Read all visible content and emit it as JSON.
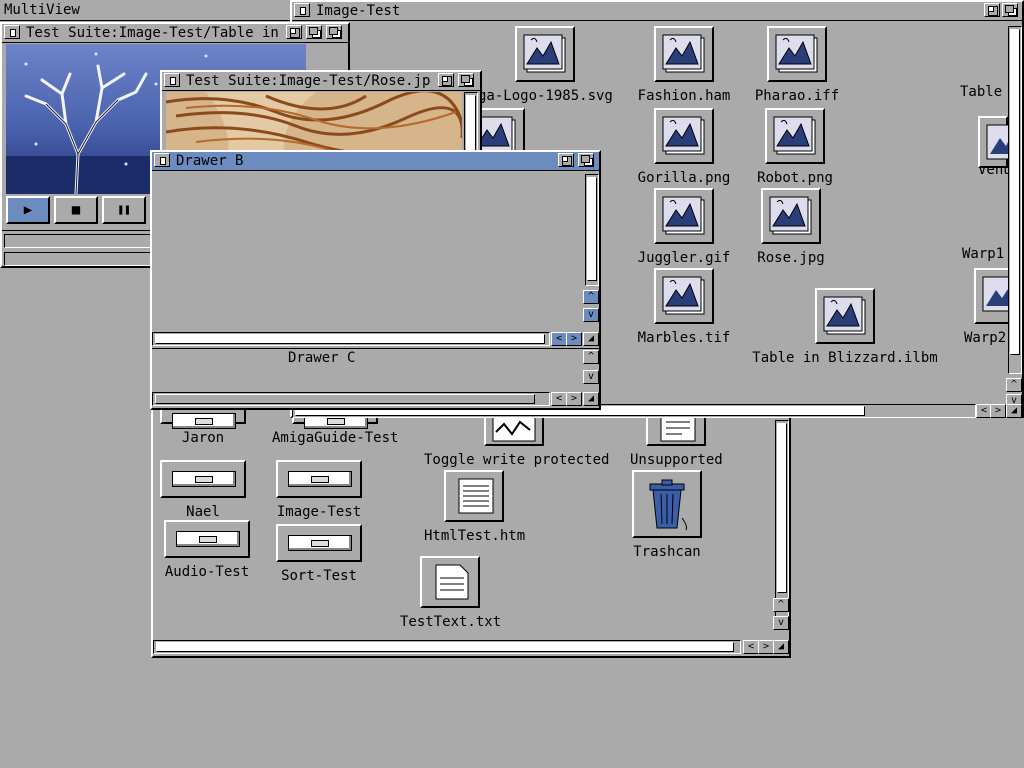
{
  "screen": {
    "title": "MultiView"
  },
  "windows": {
    "image_test": {
      "title": "Image-Test"
    },
    "table": {
      "title": "Test Suite:Image-Test/Table in"
    },
    "rose": {
      "title": "Test Suite:Image-Test/Rose.jp"
    },
    "drawer_b": {
      "title": "Drawer B"
    },
    "drawer_c": {
      "title": "Drawer C"
    }
  },
  "player": {
    "play": "▶",
    "stop": "■",
    "pause": "❚❚"
  },
  "image_icons": {
    "amiga_logo": "ga-Logo-1985.svg",
    "fashion": "Fashion.ham",
    "pharao": "Pharao.iff",
    "table": "Table",
    "gorilla": "Gorilla.png",
    "robot": "Robot.png",
    "venus": "Venu",
    "juggler": "Juggler.gif",
    "rose": "Rose.jpg",
    "warp1": "Warp1",
    "marbles": "Marbles.tif",
    "table_blizzard": "Table in Blizzard.ilbm",
    "warp2": "Warp2"
  },
  "main_icons": {
    "jaron": "Jaron",
    "amigaguide": "AmigaGuide-Test",
    "toggle": "Toggle write protected",
    "unsupported": "Unsupported",
    "nael": "Nael",
    "image_test": "Image-Test",
    "htmltest": "HtmlTest.htm",
    "trashcan": "Trashcan",
    "audio": "Audio-Test",
    "sort": "Sort-Test",
    "testtext": "TestText.txt"
  },
  "colors": {
    "background": "#aaaaaa",
    "active_title": "#6c8cc0",
    "highlight": "#ffffff",
    "shadow": "#000000"
  }
}
